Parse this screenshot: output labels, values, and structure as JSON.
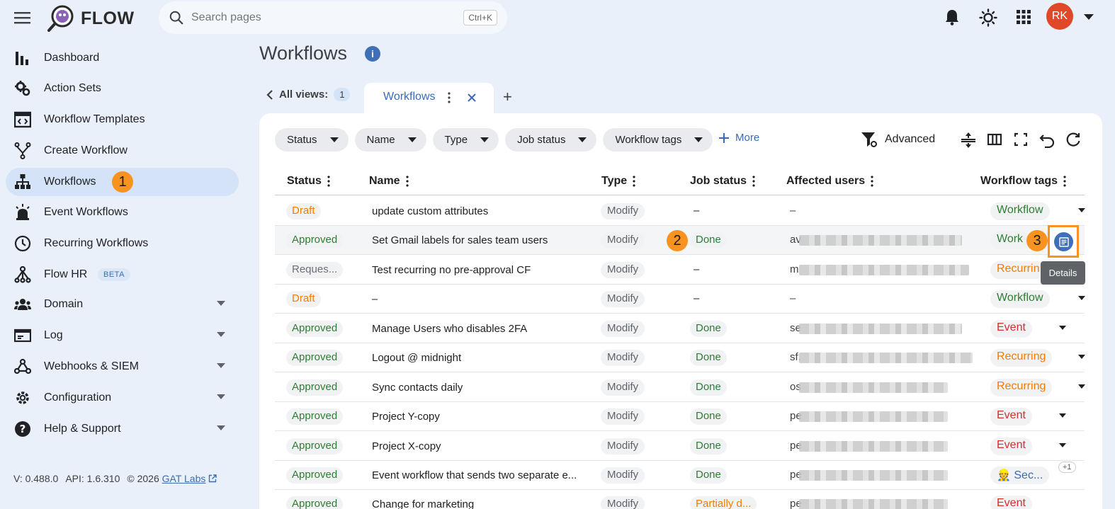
{
  "app": {
    "name": "FLOW"
  },
  "search": {
    "placeholder": "Search pages",
    "shortcut": "Ctrl+K"
  },
  "user": {
    "initials": "RK",
    "avatar_color": "#e0482a"
  },
  "sidebar": {
    "items": [
      {
        "label": "Dashboard",
        "icon": "bar-chart-icon"
      },
      {
        "label": "Action Sets",
        "icon": "gear-cog-icon"
      },
      {
        "label": "Workflow Templates",
        "icon": "code-template-icon"
      },
      {
        "label": "Create Workflow",
        "icon": "fork-icon"
      },
      {
        "label": "Workflows",
        "icon": "hierarchy-icon",
        "active": true,
        "badge": "1"
      },
      {
        "label": "Event Workflows",
        "icon": "alarm-light-icon"
      },
      {
        "label": "Recurring Workflows",
        "icon": "clock-icon"
      },
      {
        "label": "Flow HR",
        "icon": "org-tree-icon",
        "tag": "BETA"
      },
      {
        "label": "Domain",
        "icon": "users-group-icon",
        "expandable": true
      },
      {
        "label": "Log",
        "icon": "log-card-icon",
        "expandable": true
      },
      {
        "label": "Webhooks & SIEM",
        "icon": "webhook-icon",
        "expandable": true
      },
      {
        "label": "Configuration",
        "icon": "settings-icon",
        "expandable": true
      },
      {
        "label": "Help & Support",
        "icon": "help-icon",
        "expandable": true
      }
    ],
    "footer": {
      "version": "V: 0.488.0",
      "api": "API: 1.6.310",
      "copyright": "© 2026",
      "link": "GAT Labs"
    }
  },
  "page": {
    "title": "Workflows"
  },
  "views": {
    "label": "All views:",
    "count": "1",
    "active_tab": "Workflows"
  },
  "filters": [
    "Status",
    "Name",
    "Type",
    "Job status",
    "Workflow tags"
  ],
  "toolbar": {
    "more": "More",
    "advanced": "Advanced",
    "tooltip": "Details"
  },
  "annotations": {
    "a2": "2",
    "a3": "3"
  },
  "table": {
    "columns": [
      "Status",
      "Name",
      "Type",
      "Job status",
      "Affected users",
      "Workflow tags"
    ],
    "rows": [
      {
        "status": "Draft",
        "name": "update custom attributes",
        "type": "Modify",
        "job": "–",
        "affected": "–",
        "tag": "Workflow"
      },
      {
        "status": "Approved",
        "name": "Set Gmail labels for sales team users",
        "type": "Modify",
        "job": "Done",
        "affected": "av",
        "tag": "Work"
      },
      {
        "status": "Reques...",
        "name": "Test recurring no pre-approval CF",
        "type": "Modify",
        "job": "–",
        "affected": "m",
        "tag": "Recurrin"
      },
      {
        "status": "Draft",
        "name": "–",
        "type": "Modify",
        "job": "–",
        "affected": "–",
        "tag": "Workflow"
      },
      {
        "status": "Approved",
        "name": "Manage Users who disables 2FA",
        "type": "Modify",
        "job": "Done",
        "affected": "se",
        "tag": "Event"
      },
      {
        "status": "Approved",
        "name": "Logout @ midnight",
        "type": "Modify",
        "job": "Done",
        "affected": "sf.",
        "tag": "Recurring"
      },
      {
        "status": "Approved",
        "name": "Sync contacts daily",
        "type": "Modify",
        "job": "Done",
        "affected": "os",
        "tag": "Recurring"
      },
      {
        "status": "Approved",
        "name": "Project Y-copy",
        "type": "Modify",
        "job": "Done",
        "affected": "pe",
        "tag": "Event"
      },
      {
        "status": "Approved",
        "name": "Project X-copy",
        "type": "Modify",
        "job": "Done",
        "affected": "pe",
        "tag": "Event"
      },
      {
        "status": "Approved",
        "name": "Event workflow that sends two separate e...",
        "type": "Modify",
        "job": "Done",
        "affected": "pe",
        "tag": "Sec...",
        "extra": "+1"
      },
      {
        "status": "Approved",
        "name": "Change for marketing",
        "type": "Modify",
        "job": "Partially d...",
        "affected": "pe",
        "tag": "Event"
      }
    ]
  }
}
